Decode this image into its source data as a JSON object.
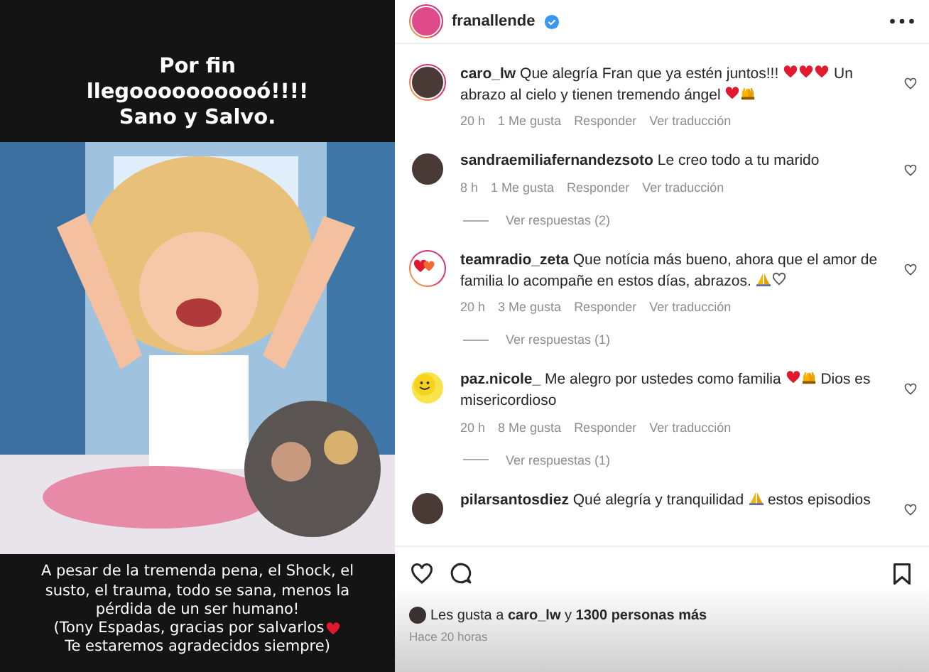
{
  "post_image": {
    "headline": [
      "Por fin",
      "llegoooooooooó!!!!",
      "Sano y Salvo."
    ],
    "caption": [
      {
        "text": "A pesar de la tremenda pena, el Shock, el susto, el trauma, todo se sana, menos la pérdida de un ser humano!",
        "heart": false
      },
      {
        "text": "(Tony Espadas, gracias por salvarlos",
        "heart": true
      },
      {
        "text": "Te estaremos agradecidos siempre)",
        "heart": false
      }
    ]
  },
  "header": {
    "username": "franallende",
    "verified": true
  },
  "comments": [
    {
      "username": "caro_lw",
      "story_ring": true,
      "kind": "person",
      "parts": [
        {
          "kind": "text",
          "text": "Que alegría Fran que ya estén juntos!!! "
        },
        {
          "kind": "heart"
        },
        {
          "kind": "heart"
        },
        {
          "kind": "heart"
        },
        {
          "kind": "text",
          "text": " Un abrazo al cielo y tienen tremendo ángel "
        },
        {
          "kind": "heart"
        },
        {
          "kind": "hands"
        }
      ],
      "time": "20 h",
      "likes": "1 Me gusta",
      "reply": "Responder",
      "translate": "Ver traducción"
    },
    {
      "username": "sandraemiliafernandezsoto",
      "story_ring": false,
      "kind": "person",
      "parts": [
        {
          "kind": "text",
          "text": "Le creo todo a tu marido"
        }
      ],
      "time": "8 h",
      "likes": "1 Me gusta",
      "reply": "Responder",
      "translate": "Ver traducción",
      "replies": "Ver respuestas (2)"
    },
    {
      "username": "teamradio_zeta",
      "story_ring": true,
      "kind": "hearts",
      "parts": [
        {
          "kind": "text",
          "text": "Que notícia más bueno, ahora que el amor de familia lo acompañe en estos días, abrazos. "
        },
        {
          "kind": "pray"
        },
        {
          "kind": "outline-heart"
        }
      ],
      "time": "20 h",
      "likes": "3 Me gusta",
      "reply": "Responder",
      "translate": "Ver traducción",
      "replies": "Ver respuestas (1)"
    },
    {
      "username": "paz.nicole_",
      "story_ring": false,
      "kind": "smiley",
      "parts": [
        {
          "kind": "text",
          "text": "Me alegro por ustedes como familia "
        },
        {
          "kind": "heart"
        },
        {
          "kind": "hands"
        },
        {
          "kind": "text",
          "text": " Dios es misericordioso"
        }
      ],
      "time": "20 h",
      "likes": "8 Me gusta",
      "reply": "Responder",
      "translate": "Ver traducción",
      "replies": "Ver respuestas (1)"
    },
    {
      "username": "pilarsantosdiez",
      "story_ring": false,
      "kind": "person",
      "parts": [
        {
          "kind": "text",
          "text": "Qué alegría y tranquilidad "
        },
        {
          "kind": "pray"
        },
        {
          "kind": "text",
          "text": " estos episodios"
        }
      ]
    }
  ],
  "likes": "Les gusta a **caro_lw** y **1300 personas más**",
  "posted": "Hace 20 horas"
}
